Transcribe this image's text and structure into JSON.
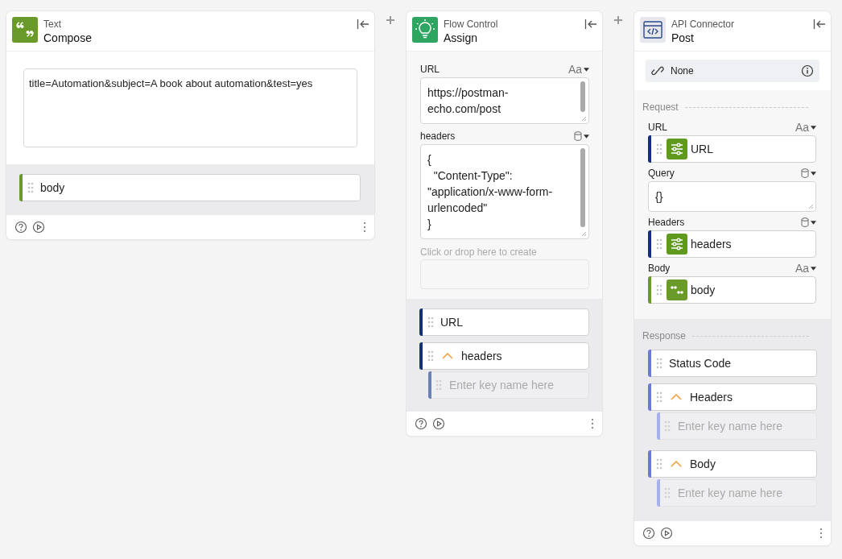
{
  "cards": [
    {
      "kind": "text",
      "category": "Text",
      "title": "Compose",
      "panels": [
        {
          "kind": "plain",
          "blocks": [
            {
              "kind": "textarea",
              "value": "title=Automation&subject=A book about automation&test=yes"
            }
          ]
        },
        {
          "kind": "outputs",
          "blocks": [
            {
              "kind": "chip",
              "label": "body",
              "color": "#6a9a2a"
            }
          ]
        }
      ]
    },
    {
      "kind": "flow",
      "category": "Flow Control",
      "title": "Assign",
      "panels": [
        {
          "kind": "inputs",
          "blocks": [
            {
              "kind": "text-field",
              "label": "URL",
              "type_text": "Aa",
              "value": "https://postman-echo.com/post",
              "scrollbar": true
            },
            {
              "kind": "data-field",
              "label": "headers",
              "value": "{\n  \"Content-Type\": \"application/x-www-form-urlencoded\"\n}",
              "scrollbar": true
            },
            {
              "kind": "dropzone",
              "label": "Click or drop here to create"
            }
          ]
        },
        {
          "kind": "outputs",
          "blocks": [
            {
              "kind": "chip",
              "label": "URL",
              "color": "#15307a"
            },
            {
              "kind": "chip",
              "label": "headers",
              "color": "#15307a",
              "expanded": true,
              "children": [
                {
                  "placeholder": "Enter key name here",
                  "color": "#6c80b8"
                }
              ]
            }
          ]
        }
      ]
    },
    {
      "kind": "api",
      "category": "API Connector",
      "title": "Post",
      "panels": [
        {
          "kind": "plain",
          "blocks": [
            {
              "kind": "connection",
              "label": "None"
            }
          ]
        },
        {
          "kind": "inputs",
          "blocks": [
            {
              "kind": "section",
              "label": "Request"
            },
            {
              "kind": "text-field",
              "label": "URL",
              "type_text": "Aa",
              "chip": {
                "label": "URL",
                "color": "#15307a",
                "kind": "variable"
              }
            },
            {
              "kind": "data-field",
              "label": "Query",
              "value": "{}"
            },
            {
              "kind": "data-field",
              "label": "Headers",
              "chip": {
                "label": "headers",
                "color": "#15307a",
                "kind": "variable"
              }
            },
            {
              "kind": "text-field",
              "label": "Body",
              "type_text": "Aa",
              "chip": {
                "label": "body",
                "color": "#6a9a2a",
                "kind": "text"
              }
            }
          ]
        },
        {
          "kind": "outputs",
          "blocks": [
            {
              "kind": "section",
              "label": "Response"
            },
            {
              "kind": "chip",
              "label": "Status Code",
              "color": "#6b7ad8"
            },
            {
              "kind": "chip",
              "label": "Headers",
              "color": "#6b7ad8",
              "expanded": true,
              "children": [
                {
                  "placeholder": "Enter key name here",
                  "color": "#a6b0ea"
                }
              ]
            },
            {
              "kind": "chip",
              "label": "Body",
              "color": "#6b7ad8",
              "expanded": true,
              "children": [
                {
                  "placeholder": "Enter key name here",
                  "color": "#a6b0ea"
                }
              ]
            }
          ]
        }
      ]
    }
  ]
}
